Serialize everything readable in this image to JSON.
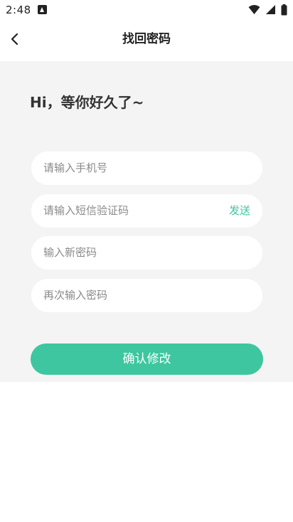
{
  "status_bar": {
    "time": "2:48",
    "icons": [
      "notification-icon",
      "wifi-icon",
      "signal-icon",
      "battery-icon"
    ]
  },
  "nav": {
    "title": "找回密码",
    "back_icon": "chevron-left-icon"
  },
  "greeting": "Hi，等你好久了~",
  "form": {
    "phone_placeholder": "请输入手机号",
    "code_placeholder": "请输入短信验证码",
    "send_label": "发送",
    "new_password_placeholder": "输入新密码",
    "confirm_password_placeholder": "再次输入密码",
    "submit_label": "确认修改"
  },
  "colors": {
    "accent": "#3ec6a0",
    "background": "#f4f4f4"
  }
}
